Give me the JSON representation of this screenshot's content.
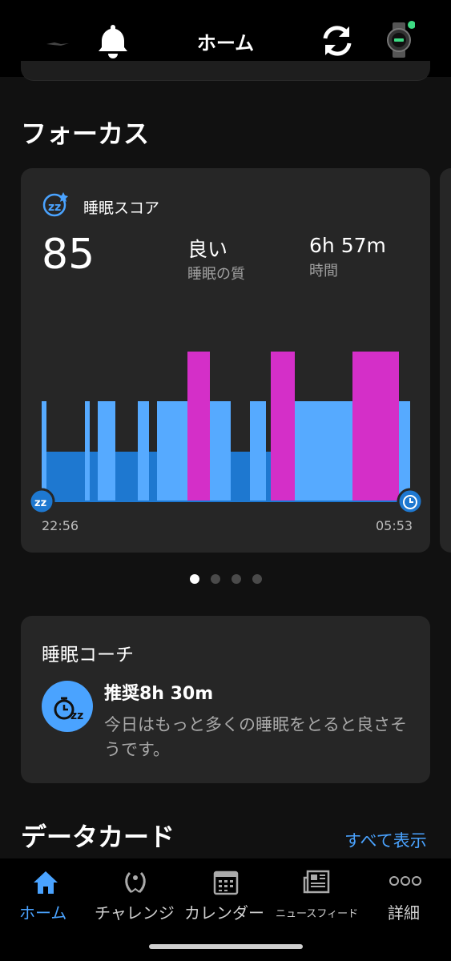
{
  "header": {
    "title": "ホーム",
    "icons": [
      "garmin-logo-icon",
      "bell-icon",
      "sync-icon",
      "watch-icon"
    ],
    "watch_status_color": "#3ddc84"
  },
  "focus": {
    "section_title": "フォーカス",
    "sleep_card": {
      "label": "睡眠スコア",
      "score": "85",
      "quality_value": "良い",
      "quality_label": "睡眠の質",
      "duration_value": "6h 57m",
      "duration_label": "時間",
      "start_time": "22:56",
      "end_time": "05:53",
      "colors": {
        "deep": "#1e78d0",
        "light": "#56aaff",
        "rem": "#d42fc8"
      }
    },
    "pager": {
      "count": 4,
      "active_index": 0
    }
  },
  "coach": {
    "title": "睡眠コーチ",
    "recommendation": "推奨8h 30m",
    "description": "今日はもっと多くの睡眠をとると良さそうです。"
  },
  "data_cards": {
    "section_title": "データカード",
    "see_all": "すべて表示"
  },
  "bottom_nav": {
    "items": [
      {
        "label": "ホーム",
        "icon": "home-icon",
        "active": true
      },
      {
        "label": "チャレンジ",
        "icon": "laurel-icon",
        "active": false
      },
      {
        "label": "カレンダー",
        "icon": "calendar-icon",
        "active": false
      },
      {
        "label": "ニュースフィード",
        "icon": "newspaper-icon",
        "active": false
      },
      {
        "label": "詳細",
        "icon": "more-dots-icon",
        "active": false
      }
    ],
    "active_color": "#4aa3ff"
  }
}
